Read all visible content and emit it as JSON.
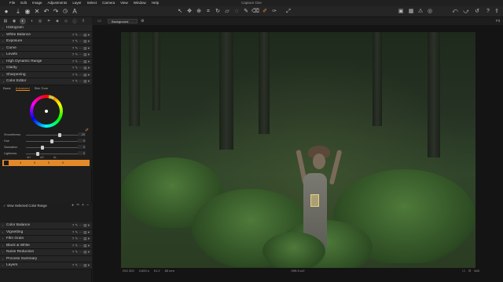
{
  "menubar": {
    "apple": "",
    "items": [
      "File",
      "Edit",
      "Image",
      "Adjustments",
      "Layer",
      "Select",
      "Camera",
      "View",
      "Window",
      "Help"
    ],
    "title": "Capture One"
  },
  "viewer_toolbar": {
    "layer": "Background",
    "zoom_label": "Fit"
  },
  "left_tools": {
    "histogram": "Histogram",
    "white_balance": "White Balance",
    "exposure": "Exposure",
    "curve": "Curve",
    "levels": "Levels",
    "hdr": "High Dynamic Range",
    "clarity": "Clarity",
    "sharpening": "Sharpening",
    "color_editor": "Color Editor",
    "color_balance": "Color Balance",
    "vignetting": "Vignetting",
    "film_grain": "Film Grain",
    "black_white": "Black & White",
    "noise_reduction": "Noise Reduction",
    "process_summary": "Process Summary",
    "layers": "Layers"
  },
  "color_editor": {
    "tabs": [
      "Basic",
      "Advanced",
      "Skin Tone"
    ],
    "active_tab": "Advanced",
    "sliders": [
      {
        "label": "Smoothness",
        "value": "20",
        "pos": 0.62
      },
      {
        "label": "Hue",
        "value": "0",
        "pos": 0.5
      },
      {
        "label": "Saturation",
        "value": "0",
        "pos": 0.5
      },
      {
        "label": "Lightness",
        "value": "0",
        "pos": 0.5
      }
    ],
    "table_headers": [
      "ΔH",
      "ΔS",
      "ΔL"
    ],
    "row": [
      "4",
      "0",
      "0",
      "0"
    ]
  },
  "view_selected": {
    "label": "View Selected Color Range",
    "swatch_color": "#4e5a1b",
    "r": "R:",
    "g": "G:",
    "b": "B:",
    "r_vals": [
      "33/35",
      "48/49",
      "7/7"
    ],
    "hsl_labels": [
      "H:",
      "S:",
      "L:"
    ],
    "hsl_vals": [
      "74/74",
      "86/86",
      "25/26"
    ]
  },
  "status": {
    "iso": "ISO 320",
    "shutter": "1/400 s",
    "aperture": "f/1.2",
    "focal": "85 mm",
    "filename": "099-9.cr2",
    "right_label": "640"
  },
  "colors": {
    "accent": "#e28a2a",
    "panel": "#1e1e1e",
    "toolbar": "#252525"
  }
}
